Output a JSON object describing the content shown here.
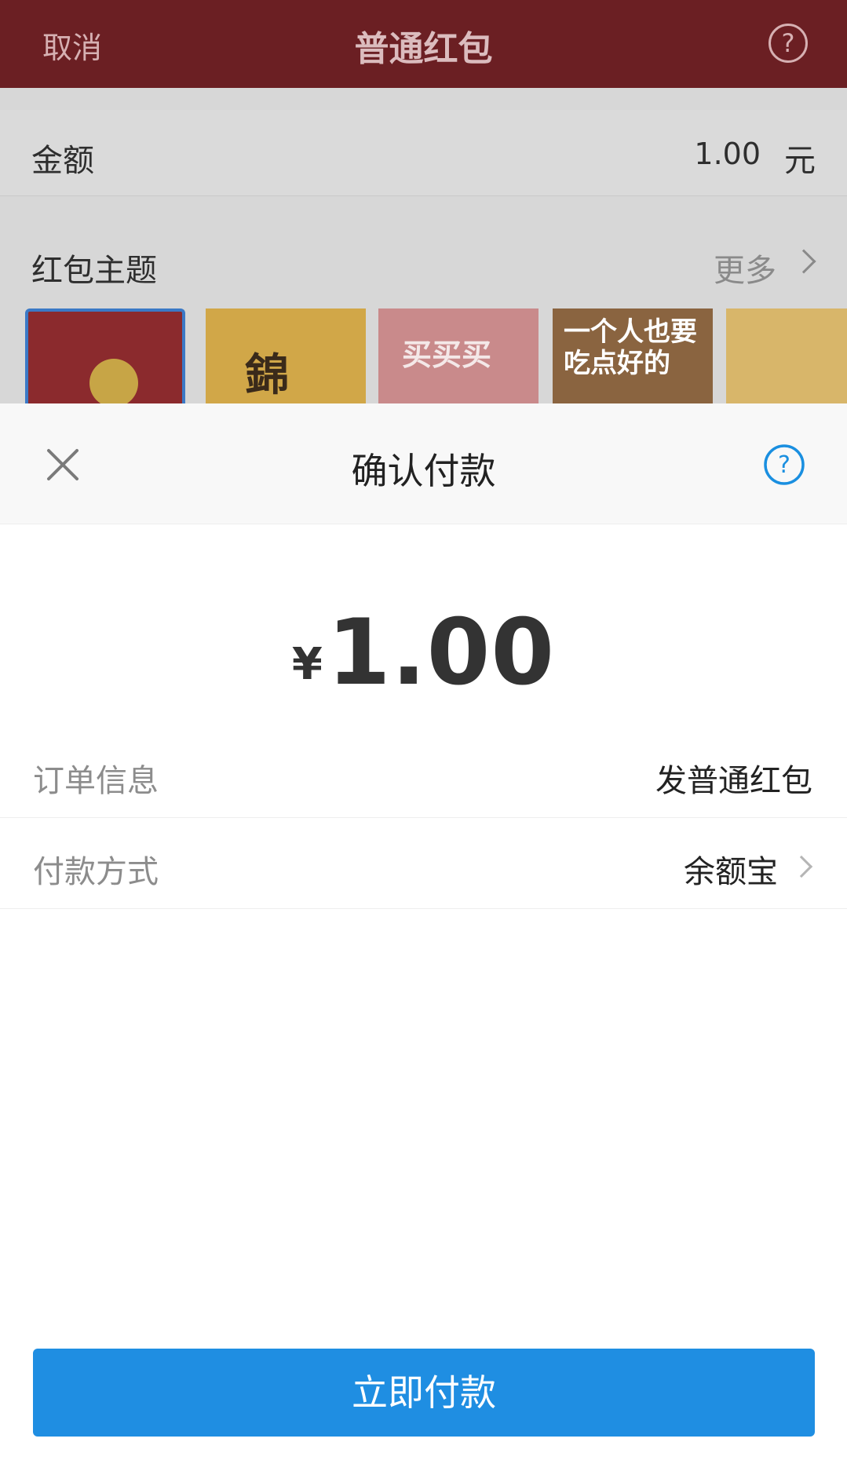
{
  "background": {
    "header": {
      "cancel": "取消",
      "title": "普通红包",
      "help_icon": "question-icon"
    },
    "amount_row": {
      "label": "金额",
      "value": "1.00",
      "unit": "元"
    },
    "theme_section": {
      "label": "红包主题",
      "more": "更多"
    },
    "themes": [
      {
        "text": ""
      },
      {
        "text": "錦"
      },
      {
        "text": "买买买"
      },
      {
        "text": "一个人也要吃点好的"
      },
      {
        "text": ""
      }
    ]
  },
  "sheet": {
    "title": "确认付款",
    "close_icon": "close-icon",
    "help_icon": "question-icon",
    "amount": {
      "currency": "¥",
      "value": "1.00"
    },
    "order": {
      "label": "订单信息",
      "value": "发普通红包"
    },
    "payment": {
      "label": "付款方式",
      "value": "余额宝"
    },
    "pay_button": "立即付款"
  },
  "colors": {
    "header_bg": "#6b1f23",
    "accent_blue": "#1f8ee2",
    "help_blue": "#1a8fe0"
  }
}
